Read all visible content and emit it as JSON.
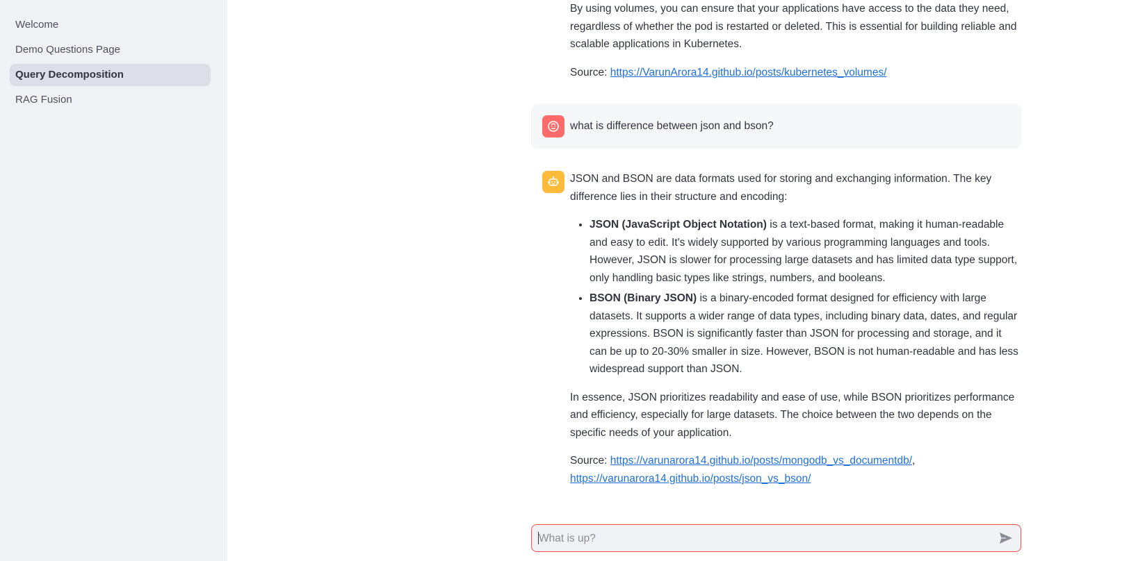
{
  "sidebar": {
    "items": [
      {
        "label": "Welcome"
      },
      {
        "label": "Demo Questions Page"
      },
      {
        "label": "Query Decomposition"
      },
      {
        "label": "RAG Fusion"
      }
    ]
  },
  "chat": {
    "prev_answer": {
      "paragraph": "By using volumes, you can ensure that your applications have access to the data they need, regardless of whether the pod is restarted or deleted. This is essential for building reliable and scalable applications in Kubernetes.",
      "source_label": "Source: ",
      "source_link": "https://VarunArora14.github.io/posts/kubernetes_volumes/"
    },
    "user_question": "what is difference between json and bson?",
    "answer": {
      "intro": "JSON and BSON are data formats used for storing and exchanging information. The key difference lies in their structure and encoding:",
      "bullets": [
        {
          "term": "JSON (JavaScript Object Notation)",
          "text": " is a text-based format, making it human-readable and easy to edit. It's widely supported by various programming languages and tools. However, JSON is slower for processing large datasets and has limited data type support, only handling basic types like strings, numbers, and booleans."
        },
        {
          "term": "BSON (Binary JSON)",
          "text": " is a binary-encoded format designed for efficiency with large datasets. It supports a wider range of data types, including binary data, dates, and regular expressions. BSON is significantly faster than JSON for processing and storage, and it can be up to 20-30% smaller in size. However, BSON is not human-readable and has less widespread support than JSON."
        }
      ],
      "conclusion": "In essence, JSON prioritizes readability and ease of use, while BSON prioritizes performance and efficiency, especially for large datasets. The choice between the two depends on the specific needs of your application.",
      "source_label": "Source: ",
      "source_link_1": "https://varunarora14.github.io/posts/mongodb_vs_documentdb/",
      "source_sep": ",",
      "source_link_2": "https://varunarora14.github.io/posts/json_vs_bson/"
    },
    "input": {
      "placeholder": "What is up?",
      "value": ""
    }
  },
  "colors": {
    "sidebar_bg": "#f0f2f6",
    "active_item_bg": "#dcdfe8",
    "user_avatar": "#ff6b6b",
    "bot_avatar": "#fdbb3c",
    "link": "#1e6fd9",
    "input_border": "#ff4b4b"
  },
  "icons": {
    "user_avatar": "smiley-face-icon",
    "bot_avatar": "robot-icon",
    "send": "send-icon"
  }
}
